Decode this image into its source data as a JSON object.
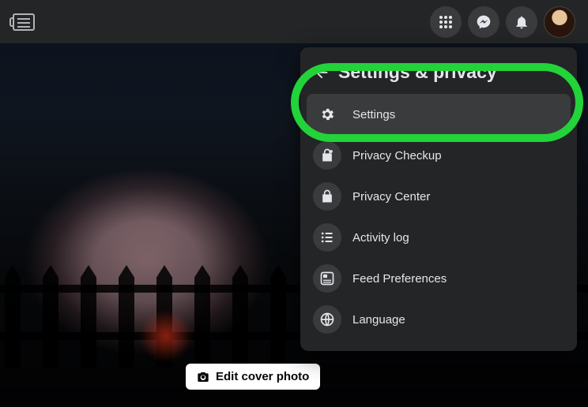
{
  "panel": {
    "title": "Settings & privacy",
    "items": [
      {
        "label": "Settings"
      },
      {
        "label": "Privacy Checkup"
      },
      {
        "label": "Privacy Center"
      },
      {
        "label": "Activity log"
      },
      {
        "label": "Feed Preferences"
      },
      {
        "label": "Language"
      }
    ]
  },
  "cover": {
    "edit_label": "Edit cover photo"
  }
}
